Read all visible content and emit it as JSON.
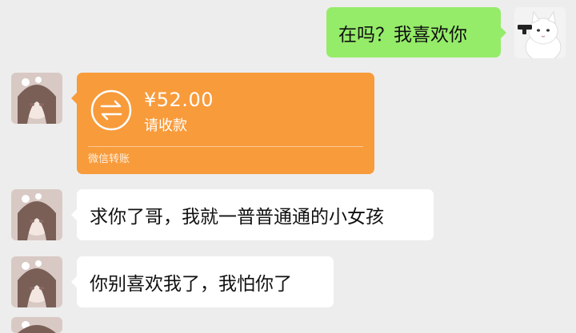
{
  "messages": {
    "me_1": "在吗？我喜欢你",
    "them_2": "求你了哥，我就一普普通通的小女孩",
    "them_3": "你别喜欢我了，我怕你了"
  },
  "transfer": {
    "amount": "¥52.00",
    "status": "请收款",
    "footer": "微信转账"
  },
  "avatars": {
    "me": "cat-gun-avatar",
    "them": "girl-avatar"
  },
  "colors": {
    "background": "#ededed",
    "my_bubble": "#95ec69",
    "their_bubble": "#ffffff",
    "transfer_card": "#f89b3b"
  }
}
